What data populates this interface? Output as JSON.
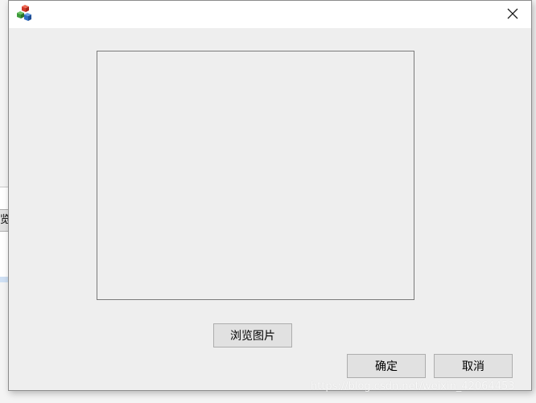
{
  "background_window": {
    "button_fragment_label": "览"
  },
  "dialog": {
    "titlebar": {
      "app_icon": "colored-cubes-icon",
      "close_icon": "close-icon"
    },
    "buttons": {
      "browse_label": "浏览图片",
      "ok_label": "确定",
      "cancel_label": "取消"
    }
  },
  "watermark": "https://blog.csdn.net/weixin_42064453"
}
